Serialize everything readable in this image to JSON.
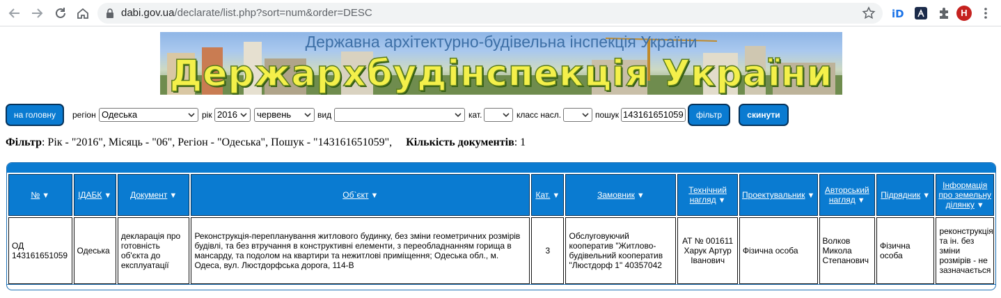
{
  "browser": {
    "url_host": "dabi.gov.ua",
    "url_path": "/declarate/list.php?sort=num&order=DESC",
    "profile_initial": "H"
  },
  "banner": {
    "top_text": "Державна архітектурно-будівельна інспекція України",
    "main_text": "Держархбудінспекція України"
  },
  "toolbar": {
    "home_label": "на головну",
    "region_label": "регіон",
    "region_value": "Одеська",
    "year_label": "рік",
    "year_value": "2016",
    "month_value": "червень",
    "type_label": "вид",
    "type_value": "",
    "category_label": "кат.",
    "category_value": "",
    "class_label": "класс насл.",
    "class_value": "",
    "search_label": "пошук",
    "search_value": "143161651059",
    "filter_label": "фільтр",
    "reset_label": "скинути"
  },
  "summary": {
    "filter_label": "Фільтр",
    "filter_text": ": Рік - \"2016\", Місяць - \"06\", Регіон - \"Одеська\", Пошук - \"143161651059\",",
    "count_label": "Кількість документів",
    "count_text": ": 1"
  },
  "table": {
    "columns": [
      {
        "label": "№",
        "label2": ""
      },
      {
        "label": "ІДАБК",
        "label2": ""
      },
      {
        "label": "Документ",
        "label2": ""
      },
      {
        "label": "Об`єкт",
        "label2": ""
      },
      {
        "label": "Кат.",
        "label2": ""
      },
      {
        "label": "Замовник",
        "label2": ""
      },
      {
        "label": "Технічний",
        "label2": "нагляд"
      },
      {
        "label": "Проектувальник",
        "label2": ""
      },
      {
        "label": "Авторський",
        "label2": "нагляд"
      },
      {
        "label": "Підрядник",
        "label2": ""
      },
      {
        "label": "Інформація про земельну",
        "label2": "ділянку"
      }
    ],
    "sort_arrow": "▼",
    "rows": [
      {
        "num": "ОД 143161651059",
        "idabk": "Одеська",
        "document": "декларація про готовність об'єкта до експлуатації",
        "object": "Реконструкція-перепланування житлового будинку, без зміни геометричних розмірів будівлі, та без втручання в конструктивні елементи, з переобладнанням горища в мансарду, та подолом на квартири та нежитлові приміщення; Одеська обл., м. Одеса, вул. Люстдорфська дорога, 114-В",
        "category": "3",
        "customer": "Обслуговуючий кооператив \"Житлово-будівельний кооператив \"Люстдорф 1\" 40357042",
        "tech_supervision": "АТ № 001611 Харук Артур Іванович",
        "designer": "Фізична особа",
        "author_supervision": "Волков Микола Степанович",
        "contractor": "Фізична особа",
        "land_info": "реконструкція та ін. без зміни розмірів - не зазначається"
      }
    ]
  }
}
